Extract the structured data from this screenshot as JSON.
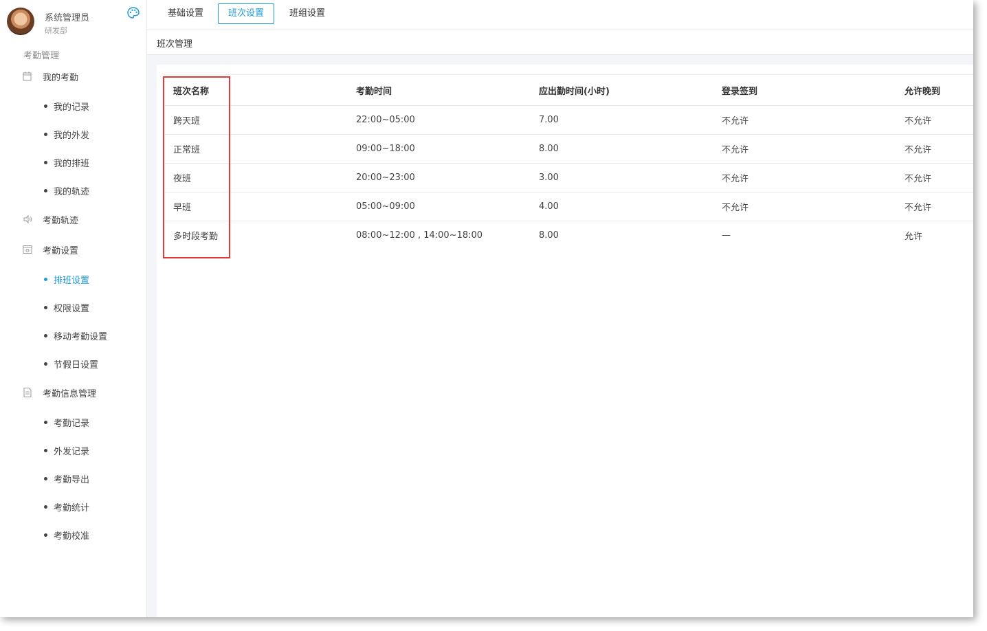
{
  "user": {
    "name": "系统管理员",
    "department": "研发部"
  },
  "sidebar": {
    "section_title": "考勤管理",
    "groups": [
      {
        "label": "我的考勤",
        "icon": "calendar-icon"
      },
      {
        "label": "考勤轨迹",
        "icon": "speaker-icon"
      },
      {
        "label": "考勤设置",
        "icon": "settings-box-icon"
      },
      {
        "label": "考勤信息管理",
        "icon": "document-icon"
      }
    ],
    "items": {
      "my_records": "我的记录",
      "my_outings": "我的外发",
      "my_schedule": "我的排班",
      "my_track": "我的轨迹",
      "shift_settings": "排班设置",
      "permission_settings": "权限设置",
      "mobile_settings": "移动考勤设置",
      "holiday_settings": "节假日设置",
      "attendance_records": "考勤记录",
      "outing_records": "外发记录",
      "attendance_export": "考勤导出",
      "attendance_stats": "考勤统计",
      "attendance_calibration": "考勤校准"
    }
  },
  "tabs": [
    "基础设置",
    "班次设置",
    "班组设置"
  ],
  "active_tab": "班次设置",
  "subheader": "班次管理",
  "table": {
    "headers": [
      "班次名称",
      "考勤时间",
      "应出勤时间(小时)",
      "登录签到",
      "允许晚到"
    ],
    "rows": [
      [
        "跨天班",
        "22:00~05:00",
        "7.00",
        "不允许",
        "不允许"
      ],
      [
        "正常班",
        "09:00~18:00",
        "8.00",
        "不允许",
        "不允许"
      ],
      [
        "夜班",
        "20:00~23:00",
        "3.00",
        "不允许",
        "不允许"
      ],
      [
        "早班",
        "05:00~09:00",
        "4.00",
        "不允许",
        "不允许"
      ],
      [
        "多时段考勤",
        "08:00~12:00 , 14:00~18:00",
        "8.00",
        "—",
        "允许"
      ]
    ]
  },
  "colors": {
    "accent": "#1e9bd7",
    "highlight": "#e53935"
  }
}
